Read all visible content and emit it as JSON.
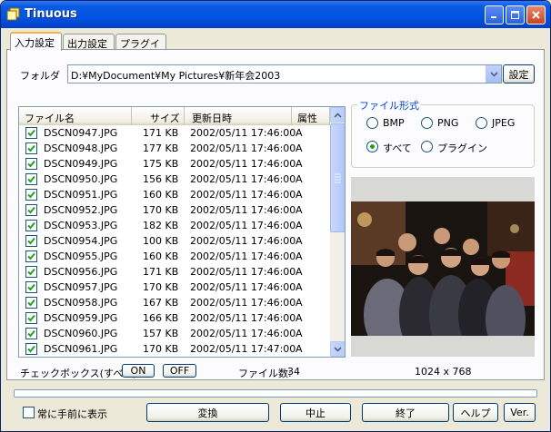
{
  "window": {
    "title": "Tinuous"
  },
  "tabs": [
    {
      "label": "入力設定",
      "active": true
    },
    {
      "label": "出力設定",
      "active": false
    },
    {
      "label": "プラグイン",
      "active": false
    }
  ],
  "folder": {
    "label": "フォルダ",
    "path": "D:¥MyDocument¥My Pictures¥新年会2003",
    "settings_button": "設定"
  },
  "file_list": {
    "columns": [
      "ファイル名",
      "サイズ",
      "更新日時",
      "属性"
    ],
    "rows": [
      {
        "name": "DSCN0947.JPG",
        "size": "171 KB",
        "date": "2002/05/11 17:46:00",
        "attr": "A",
        "checked": true
      },
      {
        "name": "DSCN0948.JPG",
        "size": "177 KB",
        "date": "2002/05/11 17:46:00",
        "attr": "A",
        "checked": true
      },
      {
        "name": "DSCN0949.JPG",
        "size": "175 KB",
        "date": "2002/05/11 17:46:00",
        "attr": "A",
        "checked": true
      },
      {
        "name": "DSCN0950.JPG",
        "size": "156 KB",
        "date": "2002/05/11 17:46:00",
        "attr": "A",
        "checked": true
      },
      {
        "name": "DSCN0951.JPG",
        "size": "160 KB",
        "date": "2002/05/11 17:46:00",
        "attr": "A",
        "checked": true
      },
      {
        "name": "DSCN0952.JPG",
        "size": "170 KB",
        "date": "2002/05/11 17:46:00",
        "attr": "A",
        "checked": true
      },
      {
        "name": "DSCN0953.JPG",
        "size": "182 KB",
        "date": "2002/05/11 17:46:00",
        "attr": "A",
        "checked": true
      },
      {
        "name": "DSCN0954.JPG",
        "size": "100 KB",
        "date": "2002/05/11 17:46:00",
        "attr": "A",
        "checked": true
      },
      {
        "name": "DSCN0955.JPG",
        "size": "160 KB",
        "date": "2002/05/11 17:46:00",
        "attr": "A",
        "checked": true
      },
      {
        "name": "DSCN0956.JPG",
        "size": "171 KB",
        "date": "2002/05/11 17:46:00",
        "attr": "A",
        "checked": true
      },
      {
        "name": "DSCN0957.JPG",
        "size": "170 KB",
        "date": "2002/05/11 17:46:00",
        "attr": "A",
        "checked": true
      },
      {
        "name": "DSCN0958.JPG",
        "size": "167 KB",
        "date": "2002/05/11 17:46:00",
        "attr": "A",
        "checked": true
      },
      {
        "name": "DSCN0959.JPG",
        "size": "166 KB",
        "date": "2002/05/11 17:46:00",
        "attr": "A",
        "checked": true
      },
      {
        "name": "DSCN0960.JPG",
        "size": "157 KB",
        "date": "2002/05/11 17:46:00",
        "attr": "A",
        "checked": true
      },
      {
        "name": "DSCN0961.JPG",
        "size": "170 KB",
        "date": "2002/05/11 17:47:00",
        "attr": "A",
        "checked": true
      }
    ]
  },
  "file_format": {
    "title": "ファイル形式",
    "options": [
      {
        "label": "BMP",
        "selected": false
      },
      {
        "label": "PNG",
        "selected": false
      },
      {
        "label": "JPEG",
        "selected": false
      },
      {
        "label": "すべて",
        "selected": true
      },
      {
        "label": "プラグイン",
        "selected": false
      }
    ]
  },
  "checkbox_controls": {
    "label": "チェックボックス(すべて)",
    "on_button": "ON",
    "off_button": "OFF"
  },
  "file_count": {
    "label": "ファイル数:",
    "value": "34"
  },
  "preview": {
    "dimensions": "1024 x 768"
  },
  "progress": {
    "value": 0
  },
  "bottom": {
    "always_on_top": "常に手前に表示",
    "convert": "変換",
    "stop": "中止",
    "exit": "終了",
    "help": "ヘルプ",
    "version": "Ver."
  },
  "colors": {
    "titlebar": "#0054e3",
    "face": "#ece9d8",
    "accent": "#0046d5",
    "checkmark": "#21a121"
  }
}
